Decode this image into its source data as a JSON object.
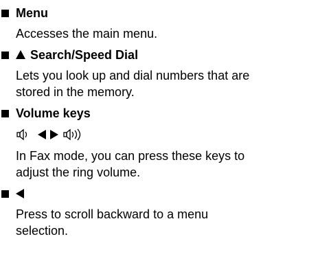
{
  "entries": [
    {
      "title": "Menu",
      "description": "Accesses the main menu."
    },
    {
      "title": "Search/Speed Dial",
      "description_line1": "Lets you look up and dial numbers that are",
      "description_line2": "stored in the memory."
    },
    {
      "title": "Volume keys",
      "keys": [
        "speaker-low-icon",
        "left-arrow-icon",
        "right-arrow-icon",
        "speaker-high-icon"
      ],
      "description_line1": "In Fax mode, you can press these keys to",
      "description_line2": "adjust the ring volume."
    },
    {
      "title_icon": "left-arrow-icon",
      "description_line1": "Press to scroll backward to a menu",
      "description_line2": "selection."
    }
  ]
}
